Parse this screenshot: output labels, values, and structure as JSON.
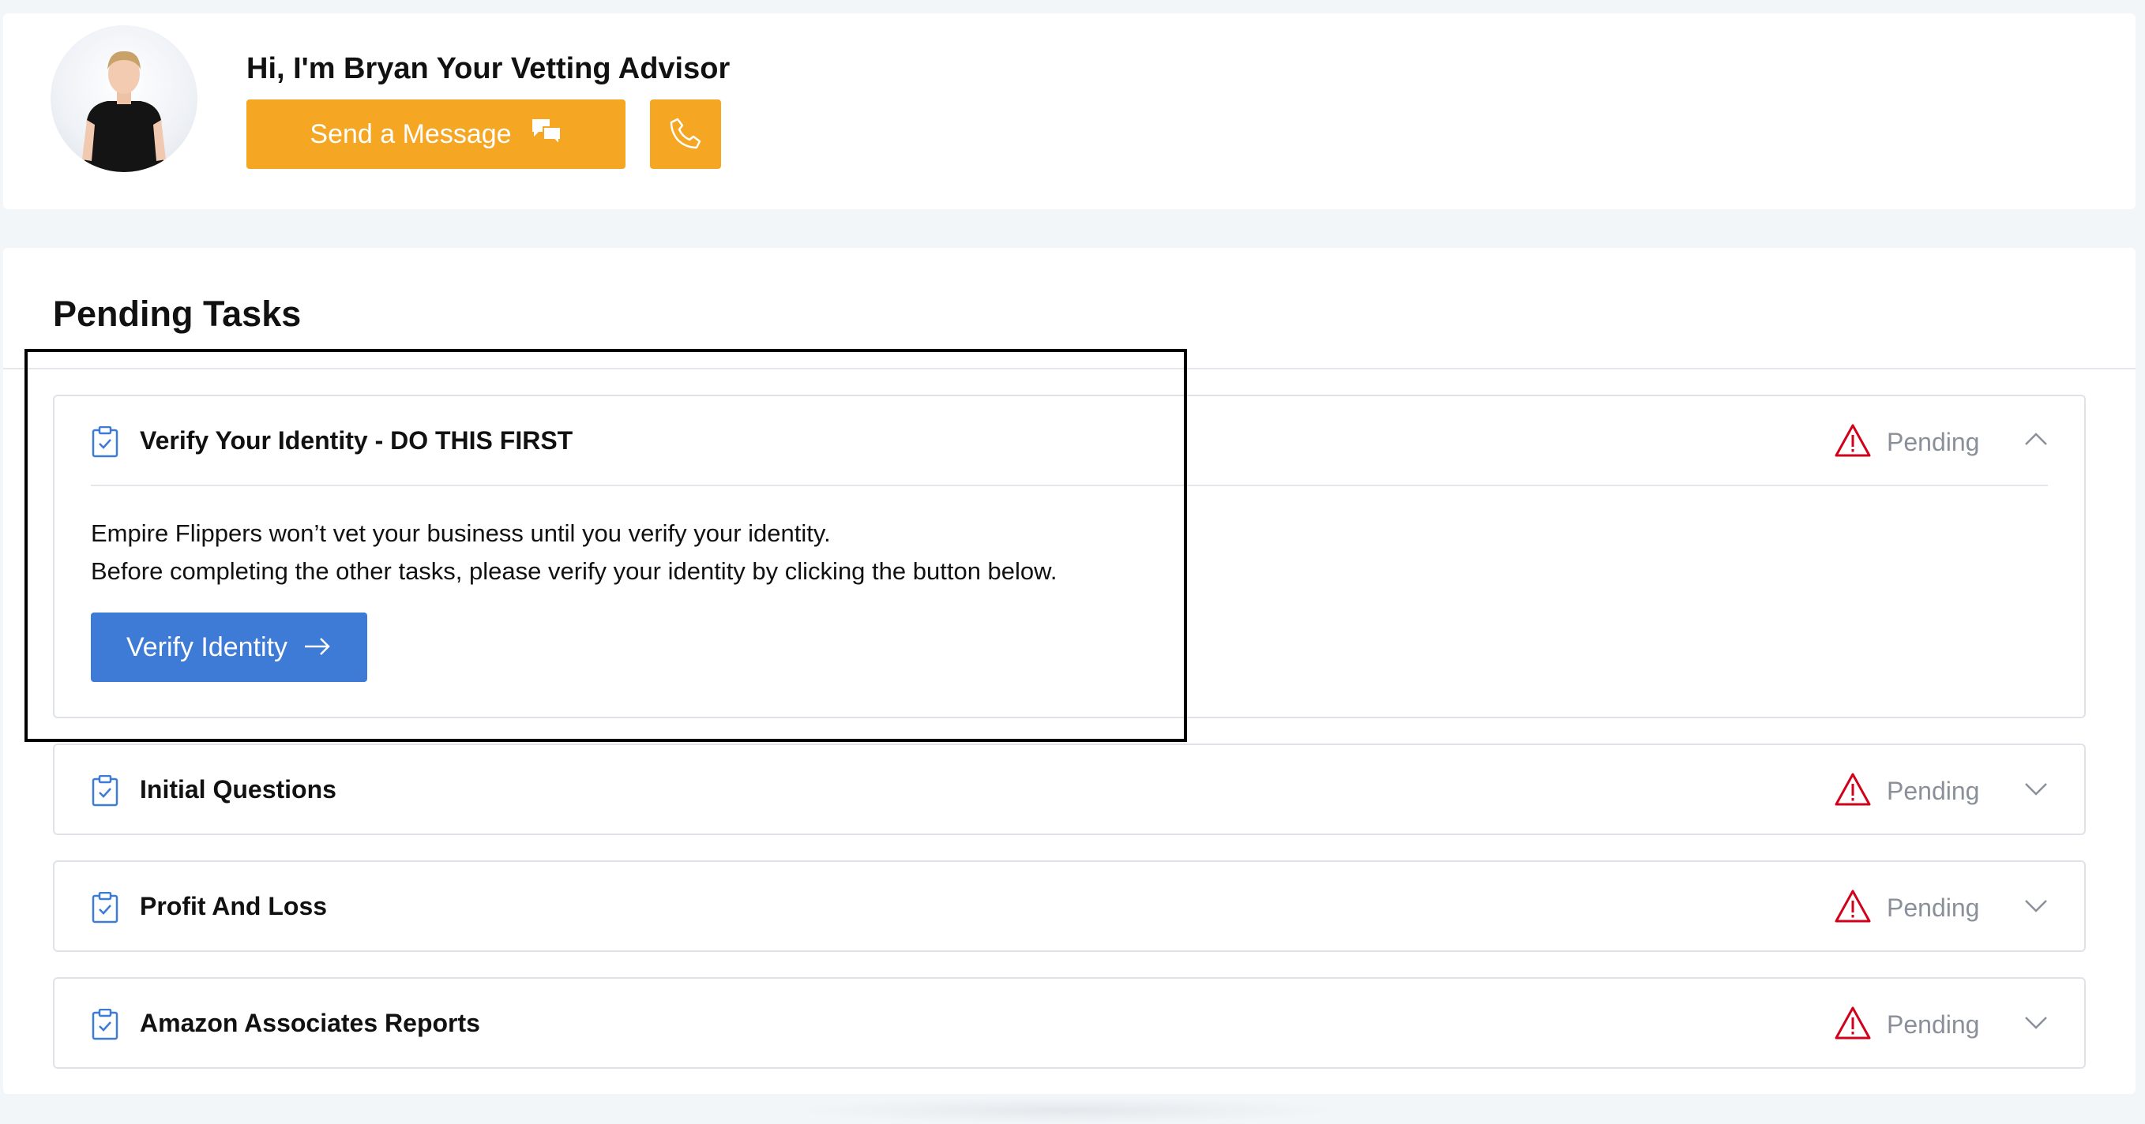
{
  "advisor": {
    "greeting": "Hi, I'm Bryan Your Vetting Advisor",
    "message_button": "Send a Message",
    "avatar_icon": "person-avatar",
    "message_icon": "chat-bubbles-icon",
    "call_icon": "phone-icon"
  },
  "pending": {
    "title": "Pending Tasks",
    "tasks": [
      {
        "title": "Verify Your Identity - DO THIS FIRST",
        "status": "Pending",
        "expanded": true,
        "description_line1": "Empire Flippers won’t vet your business until you verify your identity.",
        "description_line2": "Before completing the other tasks, please verify your identity by clicking the button below.",
        "button": "Verify Identity"
      },
      {
        "title": "Initial Questions",
        "status": "Pending",
        "expanded": false
      },
      {
        "title": "Profit And Loss",
        "status": "Pending",
        "expanded": false
      },
      {
        "title": "Amazon Associates Reports",
        "status": "Pending",
        "expanded": false
      }
    ]
  },
  "colors": {
    "accent_orange": "#f5a623",
    "primary_blue": "#3d7bd6",
    "warning_red": "#d0021b",
    "status_gray": "#8a9099"
  }
}
